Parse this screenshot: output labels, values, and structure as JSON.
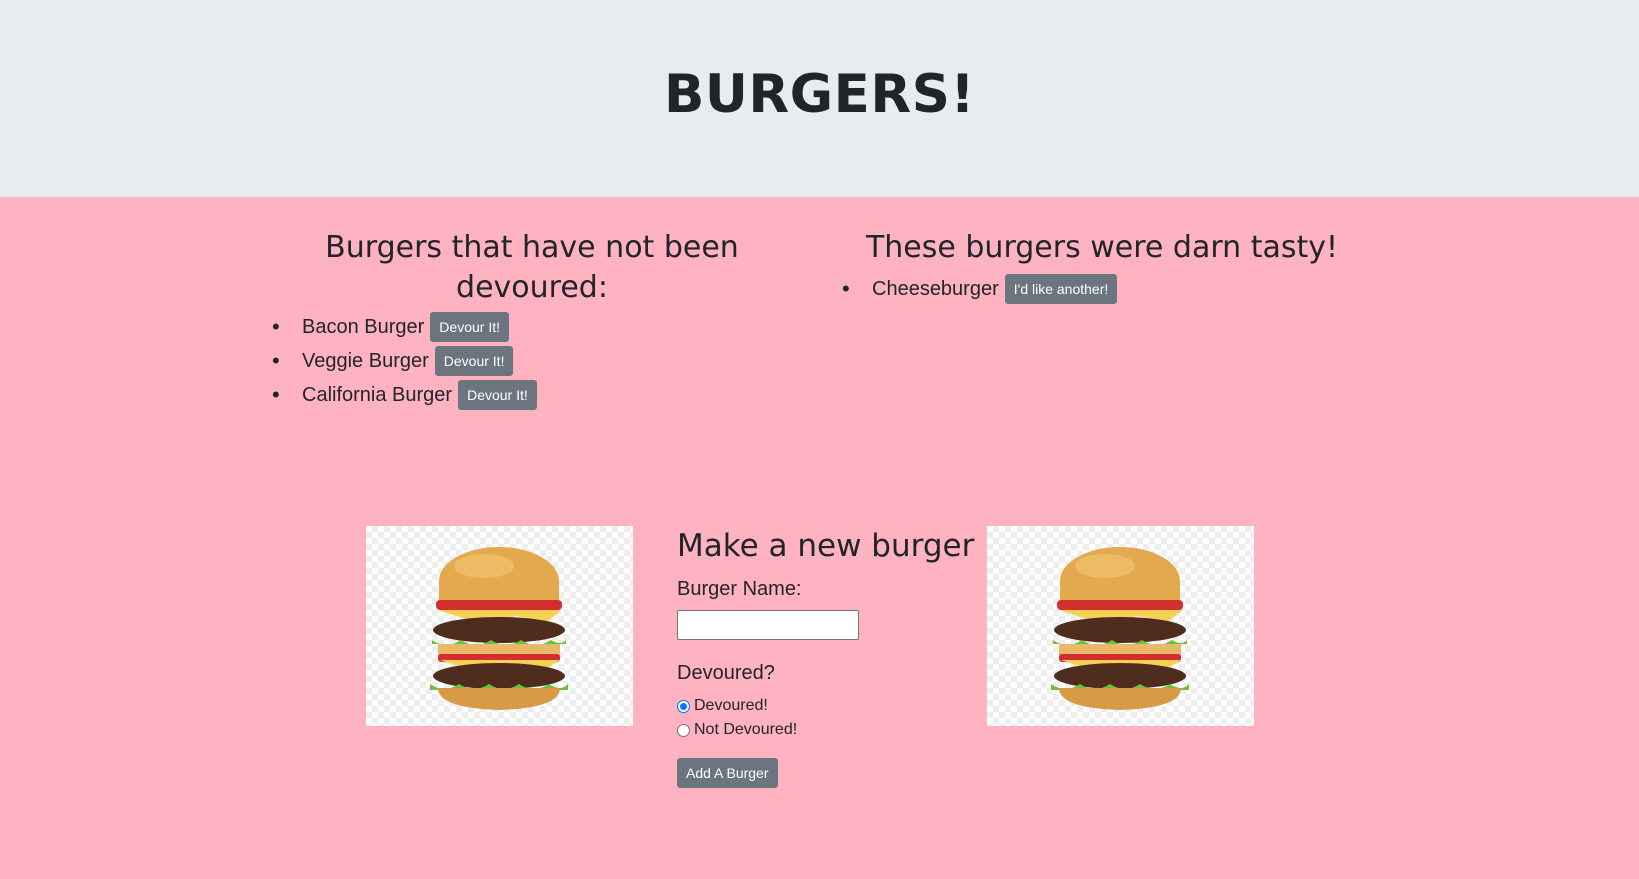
{
  "header": {
    "title": "BURGERS!"
  },
  "not_devoured": {
    "heading": "Burgers that have not been devoured:",
    "items": [
      {
        "name": "Bacon Burger",
        "button": "Devour It!"
      },
      {
        "name": "Veggie Burger",
        "button": "Devour It!"
      },
      {
        "name": "California Burger",
        "button": "Devour It!"
      }
    ]
  },
  "devoured": {
    "heading": "These burgers were darn tasty!",
    "items": [
      {
        "name": "Cheeseburger",
        "button": "I'd like another!"
      }
    ]
  },
  "form": {
    "heading": "Make a new burger",
    "name_label": "Burger Name:",
    "name_value": "",
    "devoured_label": "Devoured?",
    "options": [
      {
        "label": "Devoured!",
        "checked": true
      },
      {
        "label": "Not Devoured!",
        "checked": false
      }
    ],
    "submit": "Add A Burger"
  },
  "colors": {
    "page_background": "#ffb2bf",
    "header_background": "#e9ecef",
    "button": "#6c757d",
    "radio_accent": "#0075ff"
  },
  "icons": [
    "burger-image-left",
    "burger-image-right"
  ]
}
